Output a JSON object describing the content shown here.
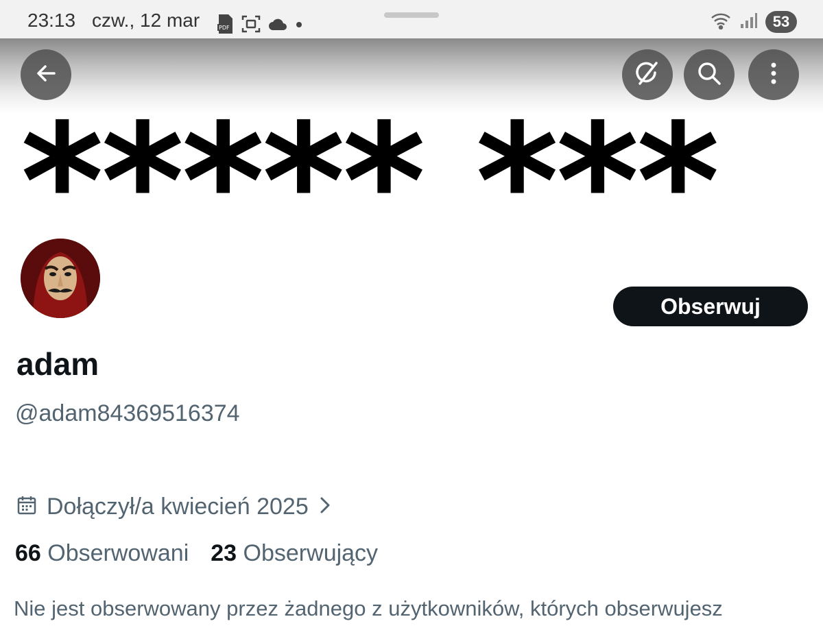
{
  "status_bar": {
    "time": "23:13",
    "date": "czw., 12 mar",
    "battery": "53",
    "icons": [
      "pdf-icon",
      "screenshot-icon",
      "cloud-icon",
      "dot-icon",
      "wifi-icon",
      "signal-icon"
    ]
  },
  "banner": {
    "text": "***** ***"
  },
  "header_actions": {
    "back": "back-arrow-icon",
    "grok": "grok-icon",
    "search": "search-icon",
    "more": "more-vertical-icon"
  },
  "profile": {
    "display_name": "adam",
    "handle": "@adam84369516374",
    "follow_label": "Obserwuj",
    "joined": "Dołączył/a kwiecień 2025",
    "following_count": "66",
    "following_label": "Obserwowani",
    "followers_count": "23",
    "followers_label": "Obserwujący",
    "not_followed_text": "Nie jest obserwowany przez żadnego z użytkowników, których obserwujesz"
  },
  "colors": {
    "primary_text": "#0f1419",
    "secondary_text": "#536471",
    "button_bg": "#0f1419"
  }
}
